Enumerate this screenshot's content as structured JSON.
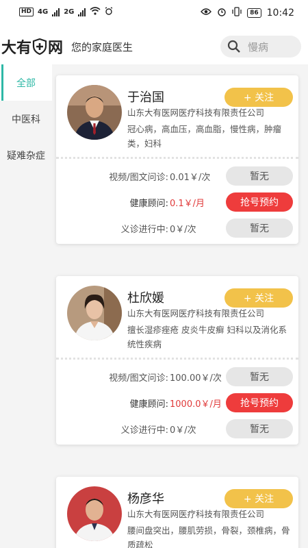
{
  "status_bar": {
    "left_text": "HD",
    "net1": "4G",
    "net2": "2G",
    "battery": "86",
    "time": "10:42"
  },
  "header": {
    "logo_left": "大有",
    "logo_right": "网",
    "slogan": "您的家庭医生",
    "search_placeholder": "慢病"
  },
  "sidebar": {
    "items": [
      {
        "label": "全部",
        "active": true
      },
      {
        "label": "中医科",
        "active": false
      },
      {
        "label": "疑难杂症",
        "active": false
      }
    ]
  },
  "doctors": [
    {
      "name": "于治国",
      "follow": "+ 关注",
      "company": "山东大有医网医疗科技有限责任公司",
      "specialty": "冠心病，高血压，高血脂，慢性病，肿瘤类，妇科",
      "rows": [
        {
          "label": "视频/图文问诊:",
          "price": "0.01￥/次",
          "button": "暂无"
        },
        {
          "label": "健康顾问:",
          "price": "0.1￥/月",
          "button": "抢号预约"
        },
        {
          "label": "义诊进行中:",
          "price": "0￥/次",
          "button": "暂无"
        }
      ]
    },
    {
      "name": "杜欣媛",
      "follow": "+ 关注",
      "company": "山东大有医网医疗科技有限责任公司",
      "specialty": "擅长湿疹痤疮 皮炎牛皮癣 妇科以及消化系统性疾病",
      "rows": [
        {
          "label": "视频/图文问诊:",
          "price": "100.00￥/次",
          "button": "暂无"
        },
        {
          "label": "健康顾问:",
          "price": "1000.0￥/月",
          "button": "抢号预约"
        },
        {
          "label": "义诊进行中:",
          "price": "0￥/次",
          "button": "暂无"
        }
      ]
    },
    {
      "name": "杨彦华",
      "follow": "+ 关注",
      "company": "山东大有医网医疗科技有限责任公司",
      "specialty": "腰间盘突出，腰肌劳损，骨裂，颈椎病，骨质疏松"
    }
  ],
  "colors": {
    "accent": "#2eb8a6",
    "follow": "#f2c24a",
    "book": "#ee3c3c",
    "price_red": "#e03a3a"
  }
}
